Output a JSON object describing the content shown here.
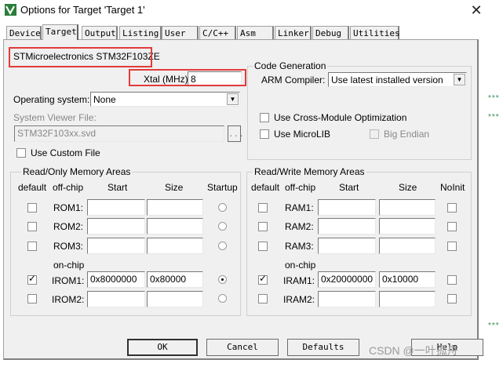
{
  "window": {
    "title": "Options for Target 'Target 1'",
    "icon": "keil-uvision-icon",
    "close_glyph": "✕"
  },
  "tabs": [
    {
      "label": "Device",
      "active": false
    },
    {
      "label": "Target",
      "active": true
    },
    {
      "label": "Output",
      "active": false
    },
    {
      "label": "Listing",
      "active": false
    },
    {
      "label": "User",
      "active": false
    },
    {
      "label": "C/C++",
      "active": false
    },
    {
      "label": "Asm",
      "active": false
    },
    {
      "label": "Linker",
      "active": false
    },
    {
      "label": "Debug",
      "active": false
    },
    {
      "label": "Utilities",
      "active": false
    }
  ],
  "device": {
    "name": "STMicroelectronics STM32F103ZE"
  },
  "xtal": {
    "label": "Xtal (MHz):",
    "value": "8"
  },
  "os": {
    "label": "Operating system:",
    "selected": "None"
  },
  "svd": {
    "label": "System Viewer File:",
    "value": "STM32F103xx.svd",
    "browse_label": "...",
    "custom_label": "Use Custom File"
  },
  "code_gen": {
    "title": "Code Generation",
    "compiler_label": "ARM Compiler:",
    "compiler_selected": "Use latest installed version",
    "cross_module_label": "Use Cross-Module Optimization",
    "microlib_label": "Use MicroLIB",
    "big_endian_label": "Big Endian"
  },
  "ro_memory": {
    "title": "Read/Only Memory Areas",
    "headers": [
      "default",
      "off-chip",
      "Start",
      "Size",
      "Startup"
    ],
    "on_chip_label": "on-chip",
    "rows": [
      {
        "name": "ROM1:",
        "start": "",
        "size": "",
        "default": false,
        "startup": false
      },
      {
        "name": "ROM2:",
        "start": "",
        "size": "",
        "default": false,
        "startup": false
      },
      {
        "name": "ROM3:",
        "start": "",
        "size": "",
        "default": false,
        "startup": false
      },
      {
        "name": "IROM1:",
        "start": "0x8000000",
        "size": "0x80000",
        "default": true,
        "startup": true
      },
      {
        "name": "IROM2:",
        "start": "",
        "size": "",
        "default": false,
        "startup": false
      }
    ]
  },
  "rw_memory": {
    "title": "Read/Write Memory Areas",
    "headers": [
      "default",
      "off-chip",
      "Start",
      "Size",
      "NoInit"
    ],
    "on_chip_label": "on-chip",
    "rows": [
      {
        "name": "RAM1:",
        "start": "",
        "size": "",
        "default": false,
        "noinit": false
      },
      {
        "name": "RAM2:",
        "start": "",
        "size": "",
        "default": false,
        "noinit": false
      },
      {
        "name": "RAM3:",
        "start": "",
        "size": "",
        "default": false,
        "noinit": false
      },
      {
        "name": "IRAM1:",
        "start": "0x20000000",
        "size": "0x10000",
        "default": true,
        "noinit": false
      },
      {
        "name": "IRAM2:",
        "start": "",
        "size": "",
        "default": false,
        "noinit": false
      }
    ]
  },
  "buttons": {
    "ok": "OK",
    "cancel": "Cancel",
    "defaults": "Defaults",
    "help": "Help"
  },
  "watermark": "CSDN @一叶孤舟",
  "colors": {
    "highlight_red": "#e33b3b",
    "dialog_bg": "#f0f0f0",
    "background_stars": "#2f8f4f"
  },
  "background_text": {
    "stars": "***"
  }
}
